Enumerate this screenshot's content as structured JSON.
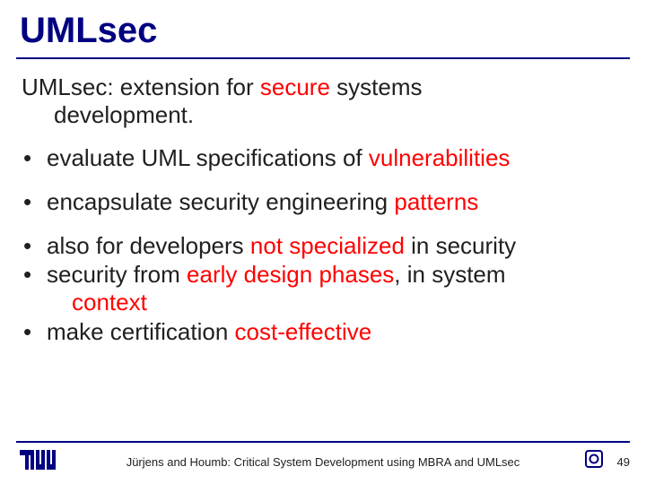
{
  "title": "UMLsec",
  "intro": {
    "prefix": "UMLsec: extension for ",
    "highlight": "secure",
    "mid": " systems",
    "line2": "development."
  },
  "bullets_a": [
    {
      "pre": "evaluate UML specifications of ",
      "hi": "vulnerabilities",
      "post": ""
    },
    {
      "pre": "encapsulate security engineering ",
      "hi": "patterns",
      "post": ""
    }
  ],
  "bullets_b": [
    {
      "pre": "also for developers ",
      "hi": "not specialized",
      "post": " in security"
    },
    {
      "pre": "security from ",
      "hi": "early design phases",
      "post": ", in system",
      "cont_hi": "context",
      "cont_post": ""
    },
    {
      "pre": "make certification ",
      "hi": "cost-effective",
      "post": ""
    }
  ],
  "footer": {
    "text": "Jürjens and Houmb: Critical System Development using MBRA and UMLsec",
    "page": "49"
  }
}
